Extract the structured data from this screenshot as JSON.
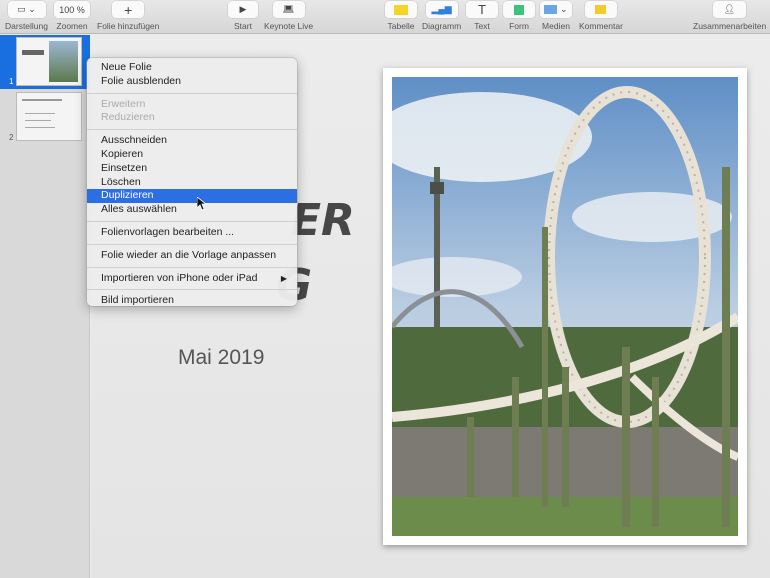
{
  "toolbar": {
    "view": "Darstellung",
    "zoom": "Zoomen",
    "zoom_value": "100 %",
    "add_slide": "Folie hinzufügen",
    "play": "Start",
    "keynote_live": "Keynote Live",
    "table": "Tabelle",
    "chart": "Diagramm",
    "text": "Text",
    "shape": "Form",
    "media": "Medien",
    "comment": "Kommentar",
    "collaborate": "Zusammenarbeiten"
  },
  "sidebar": {
    "slides": [
      {
        "number": "1"
      },
      {
        "number": "2"
      }
    ]
  },
  "slide": {
    "title_line1": "ER",
    "title_line2": "G",
    "date": "Mai 2019"
  },
  "menu": {
    "groups": [
      [
        "Neue Folie",
        "Folie ausblenden"
      ],
      [
        "Erweitern",
        "Reduzieren"
      ],
      [
        "Ausschneiden",
        "Kopieren",
        "Einsetzen",
        "Löschen",
        "Duplizieren",
        "Alles auswählen"
      ],
      [
        "Folienvorlagen bearbeiten ..."
      ],
      [
        "Folie wieder an die Vorlage anpassen"
      ],
      [
        "Importieren von iPhone oder iPad"
      ],
      [
        "Bild importieren"
      ]
    ],
    "highlighted": "Duplizieren",
    "disabled": [
      "Erweitern",
      "Reduzieren"
    ]
  },
  "colors": {
    "accent": "#1a6fe0",
    "table_icon": "#f5d327",
    "chart_icon": "#2f7fe0",
    "shape_icon": "#3cc47c",
    "comment_icon": "#f3cb2a"
  }
}
